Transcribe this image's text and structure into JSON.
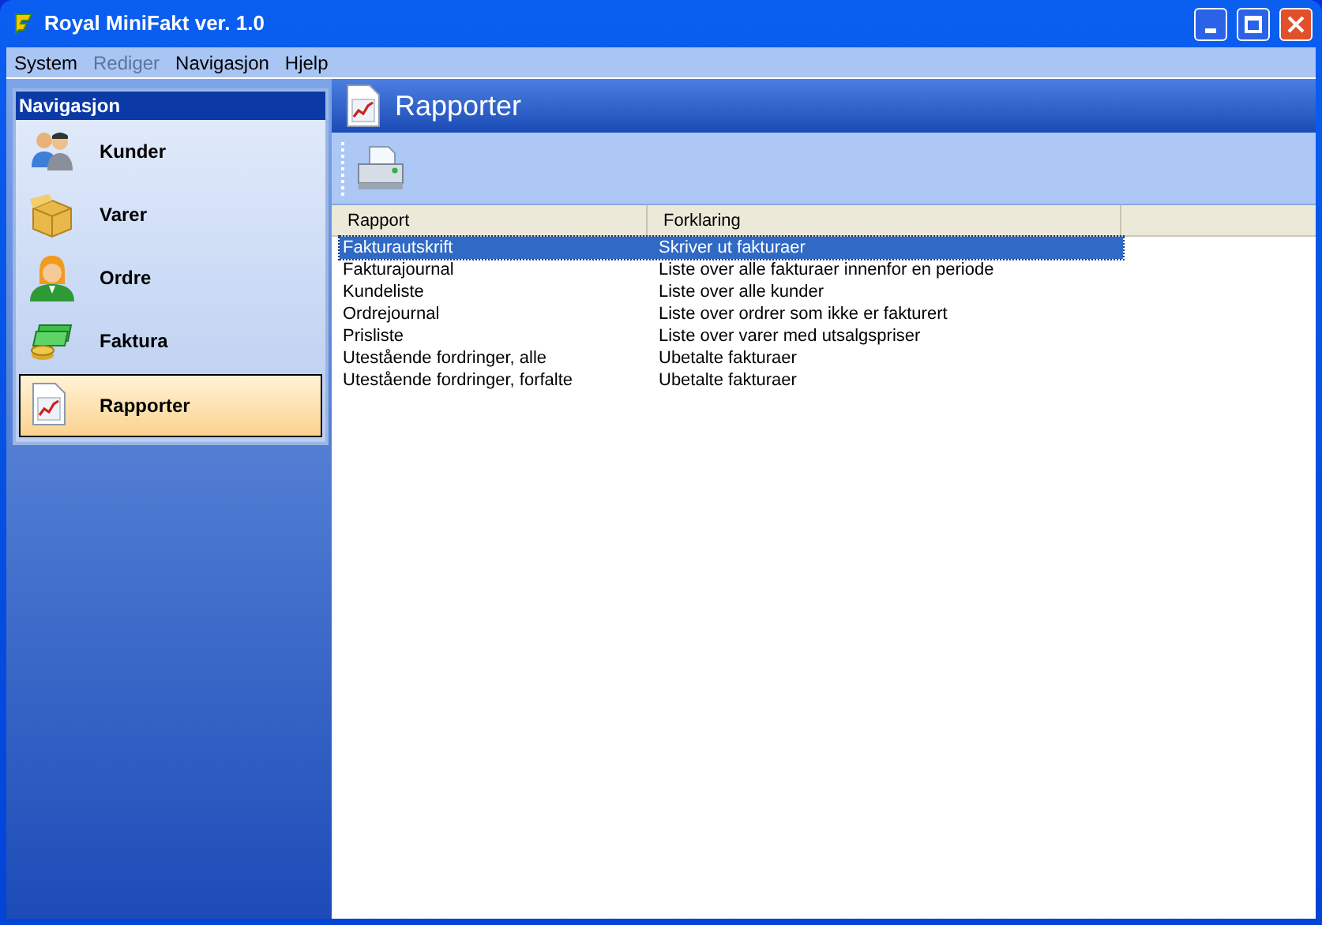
{
  "window": {
    "title": "Royal MiniFakt ver. 1.0"
  },
  "menu": [
    {
      "label": "System",
      "disabled": false
    },
    {
      "label": "Rediger",
      "disabled": true
    },
    {
      "label": "Navigasjon",
      "disabled": false
    },
    {
      "label": "Hjelp",
      "disabled": false
    }
  ],
  "sidebar": {
    "title": "Navigasjon",
    "items": [
      {
        "label": "Kunder",
        "kind": "people",
        "selected": false
      },
      {
        "label": "Varer",
        "kind": "box",
        "selected": false
      },
      {
        "label": "Ordre",
        "kind": "operator",
        "selected": false
      },
      {
        "label": "Faktura",
        "kind": "money",
        "selected": false
      },
      {
        "label": "Rapporter",
        "kind": "report",
        "selected": true
      }
    ]
  },
  "page": {
    "title": "Rapporter"
  },
  "table": {
    "columns": [
      "Rapport",
      "Forklaring"
    ],
    "rows": [
      {
        "cells": [
          "Fakturautskrift",
          "Skriver ut fakturaer"
        ],
        "selected": true
      },
      {
        "cells": [
          "Fakturajournal",
          "Liste over alle fakturaer innenfor en periode"
        ],
        "selected": false
      },
      {
        "cells": [
          "Kundeliste",
          "Liste over alle kunder"
        ],
        "selected": false
      },
      {
        "cells": [
          "Ordrejournal",
          "Liste over ordrer som ikke er fakturert"
        ],
        "selected": false
      },
      {
        "cells": [
          "Prisliste",
          "Liste over varer med utsalgspriser"
        ],
        "selected": false
      },
      {
        "cells": [
          "Utestående fordringer, alle",
          "Ubetalte fakturaer"
        ],
        "selected": false
      },
      {
        "cells": [
          "Utestående fordringer, forfalte",
          "Ubetalte fakturaer"
        ],
        "selected": false
      }
    ]
  }
}
